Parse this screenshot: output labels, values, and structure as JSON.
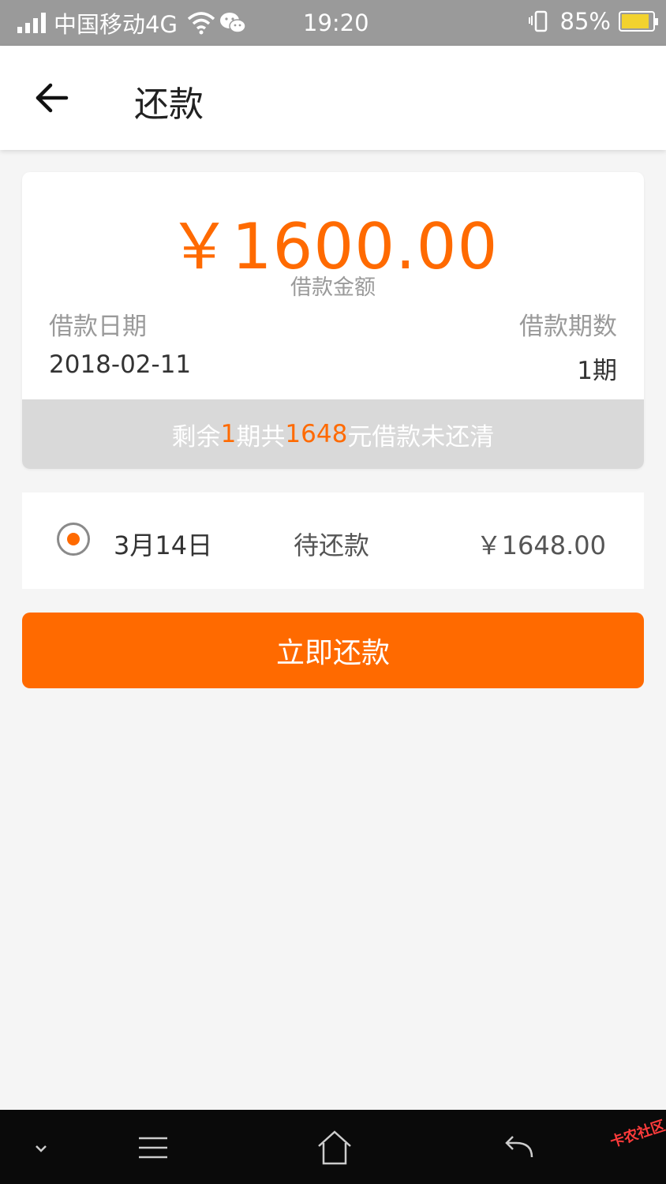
{
  "status_bar": {
    "carrier": "中国移动4G",
    "time": "19:20",
    "battery": "85%",
    "icons": [
      "signal-icon",
      "wifi-icon",
      "wechat-icon",
      "vibrate-icon",
      "battery-charging-icon"
    ]
  },
  "app_bar": {
    "title": "还款",
    "back_icon": "arrow-left-icon"
  },
  "loan": {
    "amount": "￥1600.00",
    "amount_label": "借款金额",
    "date_label": "借款日期",
    "date_value": "2018-02-11",
    "term_label": "借款期数",
    "term_value": "1期"
  },
  "summary": {
    "prefix": "剩余 ",
    "periods": "1",
    "middle": "期共 ",
    "total": "1648",
    "suffix": "元借款未还清"
  },
  "installment": {
    "selected": true,
    "date": "3月14日",
    "status": "待还款",
    "amount": "￥1648.00"
  },
  "action": {
    "repay_label": "立即还款"
  },
  "nav_bar": {
    "icons": [
      "chevron-down-icon",
      "menu-icon",
      "home-icon",
      "back-icon"
    ],
    "watermark": "卡农社区"
  },
  "colors": {
    "accent": "#ff6a00",
    "status_bar": "#9a9a9a",
    "summary_bg": "#d9d9d9"
  }
}
